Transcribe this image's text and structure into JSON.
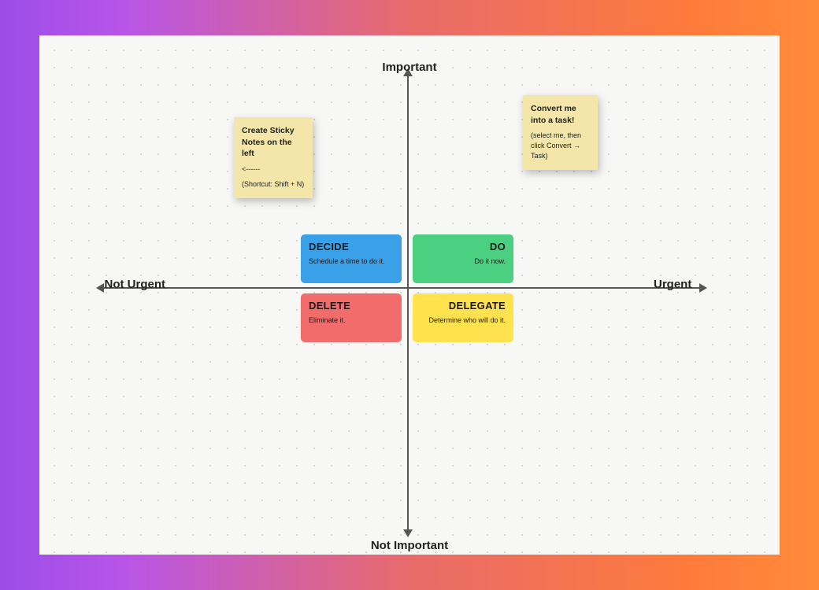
{
  "axes": {
    "top": "Important",
    "bottom": "Not Important",
    "left": "Not Urgent",
    "right": "Urgent"
  },
  "quadrants": {
    "decide": {
      "title": "DECIDE",
      "sub": "Schedule a time to do it."
    },
    "do": {
      "title": "DO",
      "sub": "Do it now."
    },
    "delete": {
      "title": "DELETE",
      "sub": "Eliminate it."
    },
    "delegate": {
      "title": "DELEGATE",
      "sub": "Determine who will do it."
    }
  },
  "sticky_left": {
    "title": "Create Sticky Notes on the left",
    "arrow": "<------",
    "hint": "(Shortcut: Shift + N)"
  },
  "sticky_right": {
    "title": "Convert me into a task!",
    "hint": "(select me, then click Convert → Task)"
  }
}
